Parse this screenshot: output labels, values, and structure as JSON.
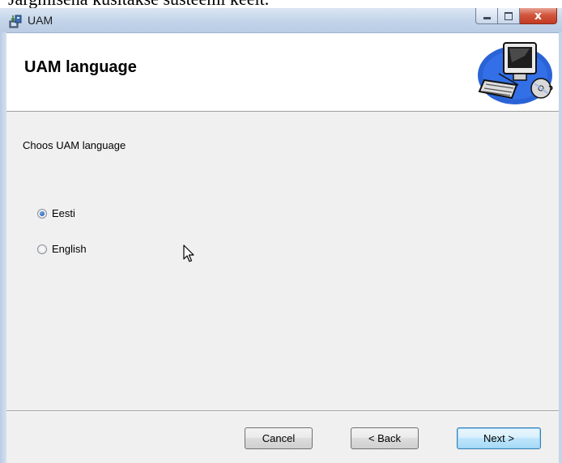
{
  "document": {
    "caption": "Järgmisena küsitakse süsteemi keelt."
  },
  "window": {
    "title": "UAM",
    "caption_buttons": {
      "minimize_icon": "minimize-icon",
      "maximize_icon": "maximize-icon",
      "close_icon": "close-icon",
      "close_glyph": "x"
    }
  },
  "banner": {
    "title": "UAM language",
    "art_icon": "computer-installer-icon"
  },
  "main": {
    "prompt": "Choos UAM language",
    "options": [
      {
        "label": "Eesti",
        "checked": true
      },
      {
        "label": "English",
        "checked": false
      }
    ]
  },
  "footer": {
    "cancel_label": "Cancel",
    "back_label": "< Back",
    "next_label": "Next >"
  },
  "colors": {
    "titlebar": "#c4d5ea",
    "close": "#c23b22",
    "default_button": "#bee6fd"
  }
}
